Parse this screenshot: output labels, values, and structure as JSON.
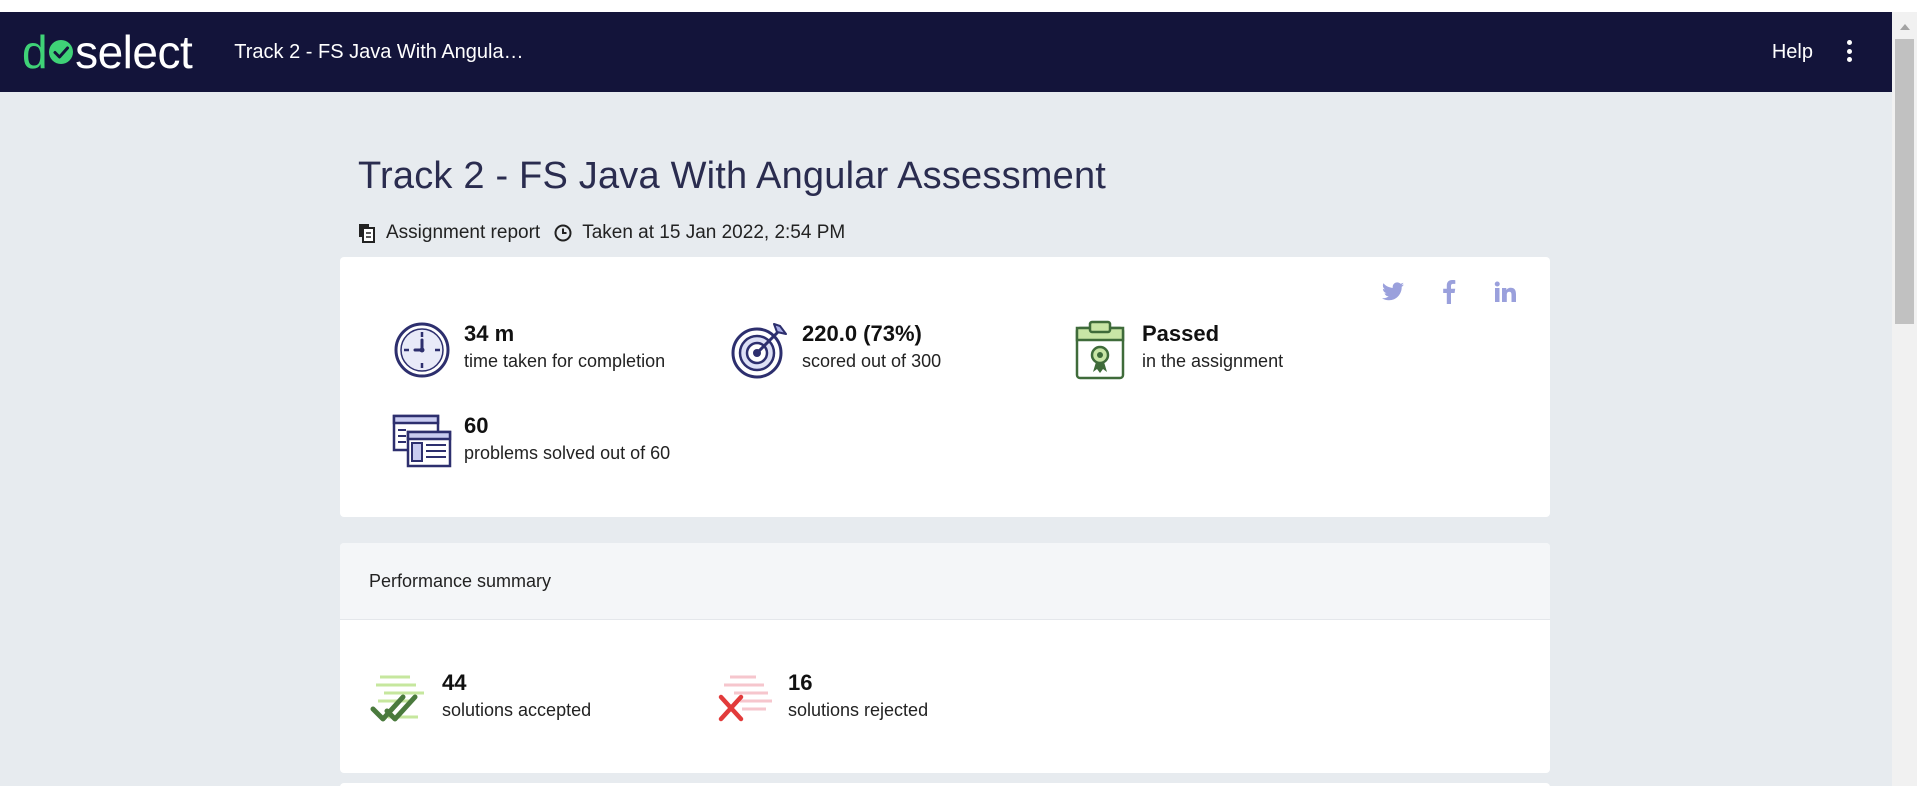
{
  "brand": {
    "logo_prefix": "d",
    "logo_suffix": "select",
    "logo_accent": "#3fd277",
    "nav_bg": "#13143a"
  },
  "nav": {
    "title": "Track 2 - FS Java With Angula…",
    "help": "Help",
    "more_icon": "kebab-menu-icon"
  },
  "report": {
    "title": "Track 2 - FS Java With Angular Assessment",
    "type_label": "Assignment report",
    "taken_at": "Taken at 15 Jan 2022, 2:54 PM"
  },
  "social": [
    "twitter-icon",
    "facebook-icon",
    "linkedin-icon"
  ],
  "stats": {
    "time": {
      "value": "34 m",
      "label": "time taken for completion",
      "icon": "clock-icon"
    },
    "score": {
      "value": "220.0 (73%)",
      "label": "scored out of 300",
      "icon": "target-icon"
    },
    "result": {
      "value": "Passed",
      "label": "in the assignment",
      "icon": "certificate-clipboard-icon"
    },
    "problems": {
      "value": "60",
      "label": "problems solved out of 60",
      "icon": "problems-window-icon"
    }
  },
  "performance": {
    "heading": "Performance summary",
    "accepted": {
      "value": "44",
      "label": "solutions accepted",
      "icon": "double-check-icon",
      "color": "#4a7a3d"
    },
    "rejected": {
      "value": "16",
      "label": "solutions rejected",
      "icon": "cross-icon",
      "color": "#e23b3b"
    }
  }
}
